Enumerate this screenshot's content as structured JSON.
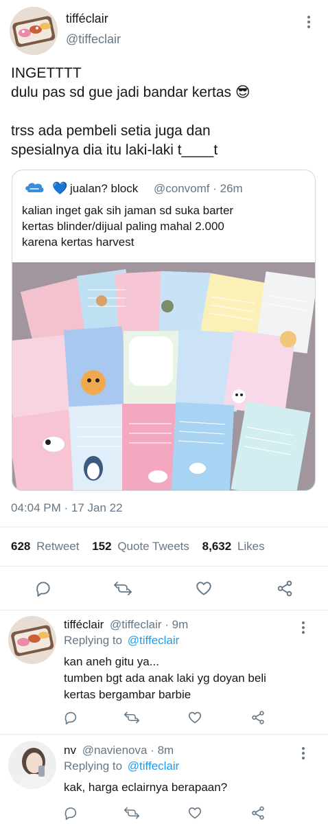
{
  "tweet": {
    "display_name": "tifféclair",
    "handle": "@tiffeclair",
    "text": "INGETTTT\ndulu pas sd gue jadi bandar kertas 😎\n\ntrss ada pembeli setia juga dan\nspesialnya dia itu laki-laki t____t",
    "timestamp": "04:04 PM · 17 Jan 22",
    "stats": {
      "retweets": "628",
      "retweets_label": "Retweet",
      "quotes": "152",
      "quotes_label": "Quote Tweets",
      "likes": "8,632",
      "likes_label": "Likes"
    }
  },
  "quoted": {
    "heart": "💙",
    "name": "jualan? block",
    "handle_time": "@convomf · 26m",
    "text": "kalian inget gak sih jaman sd suka barter\nkertas blinder/dijual paling mahal 2.000\nkarena kertas harvest"
  },
  "replies": [
    {
      "name": "tifféclair",
      "handle_time": "@tiffeclair · 9m",
      "replying_prefix": "Replying to",
      "replying_to": "@tiffeclair",
      "text": "kan aneh gitu ya...\ntumben bgt ada anak laki yg doyan beli\nkertas bergambar barbie"
    },
    {
      "name": "nv",
      "handle_time": "@navienova · 8m",
      "replying_prefix": "Replying to",
      "replying_to": "@tiffeclair",
      "text": "kak, harga eclairnya berapaan?"
    }
  ],
  "icons": {
    "reply": "reply-icon",
    "retweet": "retweet-icon",
    "like": "heart-icon",
    "share": "share-icon"
  },
  "colors": {
    "text": "#14171a",
    "secondary": "#657786",
    "link": "#1d9bf0",
    "divider": "#e6ecf0"
  }
}
